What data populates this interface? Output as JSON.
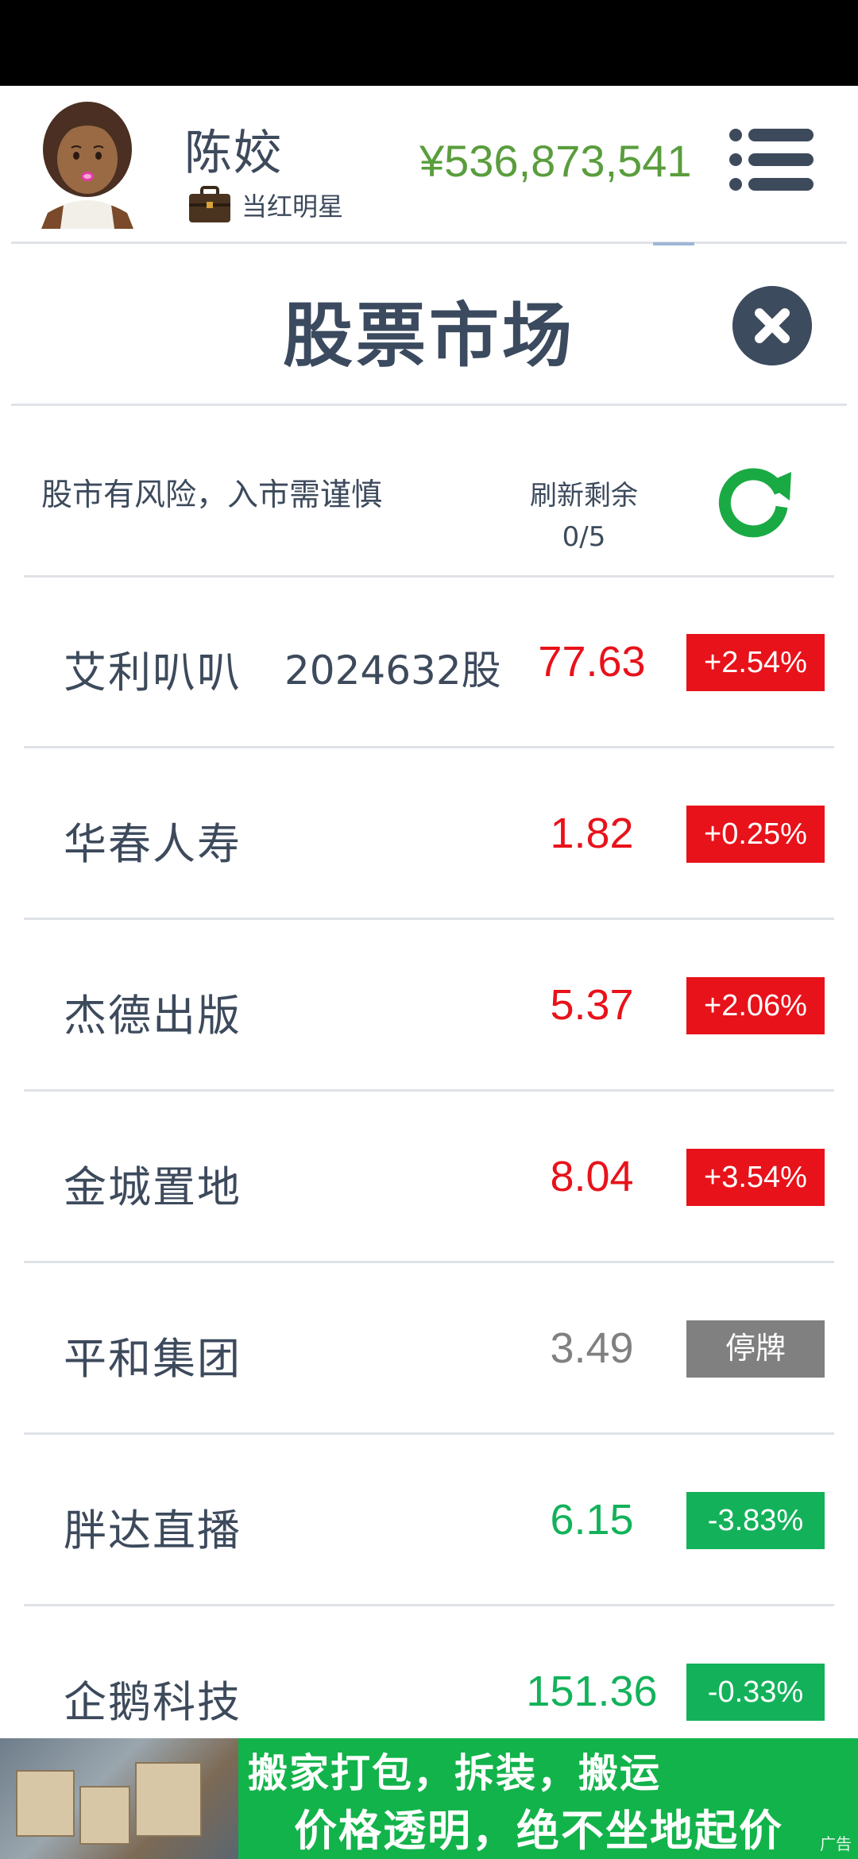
{
  "header": {
    "player_name": "陈姣",
    "player_title": "当红明星",
    "money": "¥536,873,541"
  },
  "panel": {
    "title": "股票市场",
    "warning": "股市有风险，入市需谨慎",
    "refresh_label": "刷新剩余",
    "refresh_count": "0/5"
  },
  "stocks": [
    {
      "name": "艾利叭叭",
      "holding": "2024632股",
      "price": "77.63",
      "change": "+2.54%",
      "status": "up"
    },
    {
      "name": "华春人寿",
      "holding": "",
      "price": "1.82",
      "change": "+0.25%",
      "status": "up"
    },
    {
      "name": "杰德出版",
      "holding": "",
      "price": "5.37",
      "change": "+2.06%",
      "status": "up"
    },
    {
      "name": "金城置地",
      "holding": "",
      "price": "8.04",
      "change": "+3.54%",
      "status": "up"
    },
    {
      "name": "平和集团",
      "holding": "",
      "price": "3.49",
      "change": "停牌",
      "status": "halted"
    },
    {
      "name": "胖达直播",
      "holding": "",
      "price": "6.15",
      "change": "-3.83%",
      "status": "down"
    },
    {
      "name": "企鹅科技",
      "holding": "",
      "price": "151.36",
      "change": "-0.33%",
      "status": "down"
    }
  ],
  "colors": {
    "up": "#e8121a",
    "down": "#13b25a",
    "halted": "#808080",
    "money": "#5a9d3d",
    "refresh": "#1aaa44"
  },
  "ad": {
    "line1": "搬家打包，拆装，搬运",
    "line2": "价格透明，绝不坐地起价",
    "tag": "广告"
  }
}
